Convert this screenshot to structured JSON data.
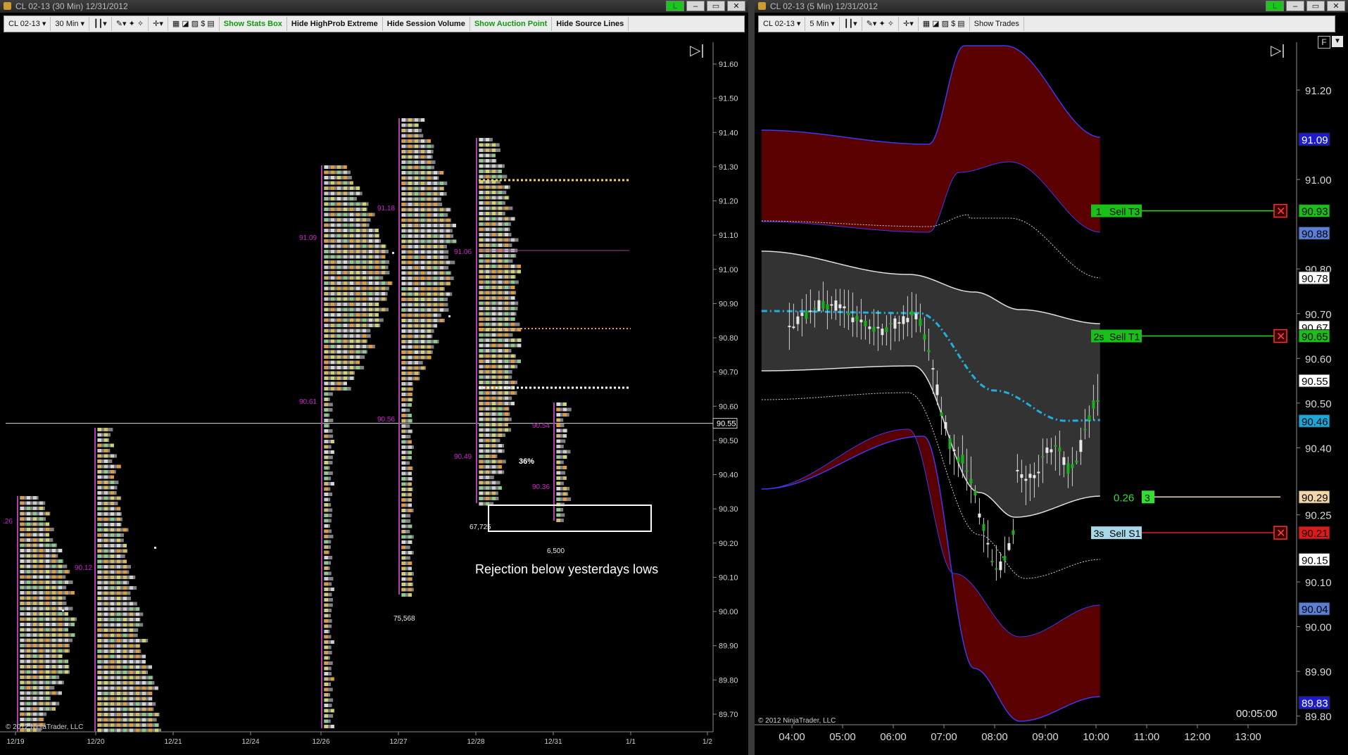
{
  "left_window": {
    "title": "CL 02-13 (30 Min)  12/31/2012",
    "window_buttons": [
      "L",
      "–",
      "▭",
      "✕"
    ],
    "toolbar": {
      "instrument": "CL 02-13",
      "interval": "30 Min",
      "buttons": [
        "Show Stats Box",
        "Hide HighProb Extreme",
        "Hide Session Volume",
        "Show Auction Point",
        "Hide Source Lines"
      ]
    },
    "price_axis": [
      "91.60",
      "91.50",
      "91.40",
      "91.30",
      "91.20",
      "91.10",
      "91.00",
      "90.90",
      "90.80",
      "90.70",
      "90.60",
      "90.50",
      "90.40",
      "90.30",
      "90.20",
      "90.10",
      "90.00",
      "89.90",
      "89.80",
      "89.70"
    ],
    "current_price": "90.55",
    "date_axis": [
      "12/19",
      "12/20",
      "12/21",
      "12/24",
      "12/26",
      "12/27",
      "12/28",
      "12/31",
      "1/1",
      "1/2"
    ],
    "profile_labels": {
      "p1_left": ".26",
      "p2_left": "90.12",
      "p3_high": "91.09",
      "p3_low": "90.61",
      "p4_high": "91.18",
      "p4_low": "90.56",
      "p5_high": "91.06",
      "p5_low": "90.49",
      "p6_high": "90.54",
      "p6_low": "90.36"
    },
    "volumes": {
      "v4": "75,568",
      "v5": "67,725",
      "v6": "6,500"
    },
    "percent": "36%",
    "annotation": "Rejection below yesterdays lows",
    "copyright": "© 2012 NinjaTrader, LLC"
  },
  "right_window": {
    "title": "CL 02-13 (5 Min)  12/31/2012",
    "window_buttons": [
      "L",
      "–",
      "▭",
      "✕"
    ],
    "toolbar": {
      "instrument": "CL 02-13",
      "interval": "5 Min",
      "buttons": [
        "Show Trades"
      ]
    },
    "price_axis": [
      "91.20",
      "91.00",
      "90.80",
      "90.70",
      "90.60",
      "90.50",
      "90.40",
      "90.25",
      "90.10",
      "90.00",
      "89.90",
      "89.80"
    ],
    "price_tags": [
      {
        "value": "91.09",
        "color": "#1c1ccc"
      },
      {
        "value": "90.93",
        "color": "#18c018"
      },
      {
        "value": "90.88",
        "color": "#5a7fd6"
      },
      {
        "value": "90.78",
        "color": "#ffffff"
      },
      {
        "value": "90.67",
        "color": "#ffffff"
      },
      {
        "value": "90.65",
        "color": "#18c018"
      },
      {
        "value": "90.55",
        "color": "#ffffff"
      },
      {
        "value": "90.46",
        "color": "#1fa6d8"
      },
      {
        "value": "90.29",
        "color": "#f2d6a8"
      },
      {
        "value": "90.21",
        "color": "#e01818"
      },
      {
        "value": "90.15",
        "color": "#ffffff"
      },
      {
        "value": "90.04",
        "color": "#5a7fd6"
      },
      {
        "value": "89.83",
        "color": "#1c1ccc"
      }
    ],
    "orders": [
      {
        "qty": "1",
        "label": "Sell T3",
        "color": "#18c018"
      },
      {
        "qty": "2s",
        "label": "Sell T1",
        "color": "#18c018"
      },
      {
        "qty": "3s",
        "label": "Sell S1",
        "color": "#a8d8e8"
      }
    ],
    "position": {
      "pnl": "0.26",
      "qty": "3"
    },
    "time_axis": [
      "04:00",
      "05:00",
      "06:00",
      "07:00",
      "08:00",
      "09:00",
      "10:00",
      "11:00",
      "12:00",
      "13:00"
    ],
    "bar_timer": "00:05:00",
    "copyright": "© 2012 NinjaTrader, LLC",
    "f_button": "F"
  }
}
